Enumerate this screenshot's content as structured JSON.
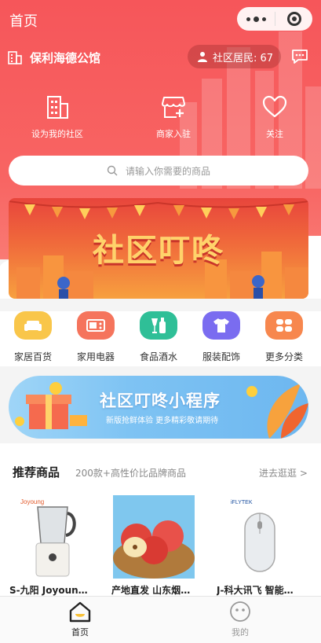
{
  "topbar": {
    "title": "首页"
  },
  "community": {
    "name": "保利海德公馆",
    "residents_label": "社区居民: 67"
  },
  "actions": [
    {
      "label": "设为我的社区",
      "icon": "building-icon"
    },
    {
      "label": "商家入驻",
      "icon": "shop-add-icon"
    },
    {
      "label": "关注",
      "icon": "heart-icon"
    }
  ],
  "search": {
    "placeholder": "请输入你需要的商品"
  },
  "banner": {
    "title": "社区叮咚"
  },
  "categories": [
    {
      "label": "家居百货",
      "icon": "sofa-icon",
      "color": "#f9c64a"
    },
    {
      "label": "家用电器",
      "icon": "appliance-icon",
      "color": "#f5745c"
    },
    {
      "label": "食品酒水",
      "icon": "drinks-icon",
      "color": "#2fbf97"
    },
    {
      "label": "服装配饰",
      "icon": "tshirt-icon",
      "color": "#7a6cf0"
    },
    {
      "label": "更多分类",
      "icon": "grid-icon",
      "color": "#f7874e"
    }
  ],
  "mini_program": {
    "title": "社区叮咚小程序",
    "subtitle": "新版抢鲜体验 更多精彩敬请期待"
  },
  "recommend": {
    "title": "推荐商品",
    "subtitle": "200款+高性价比品牌商品",
    "more": "进去逛逛 >"
  },
  "products": [
    {
      "name": "S-九阳 Joyoung 破壁机"
    },
    {
      "name": "产地直发 山东烟台苹果"
    },
    {
      "name": "J-科大讯飞 智能鼠标"
    }
  ],
  "tabs": [
    {
      "label": "首页",
      "icon": "home-icon",
      "active": true
    },
    {
      "label": "我的",
      "icon": "smiley-icon",
      "active": false
    }
  ],
  "colors": {
    "brand": "#f6565a",
    "active_tab": "#222222",
    "inactive_tab": "#999999"
  }
}
